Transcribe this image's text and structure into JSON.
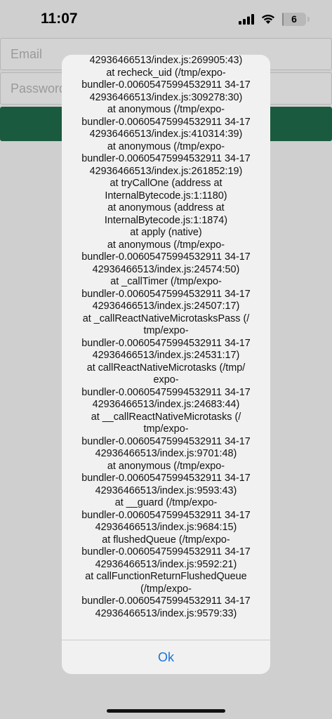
{
  "status_bar": {
    "time": "11:07",
    "battery_level": "6",
    "battery_fraction": 0.06
  },
  "login_form": {
    "email_placeholder": "Email",
    "password_placeholder": "Password"
  },
  "alert": {
    "lines": [
      "42936466513/index.js:269905:43)",
      "at recheck_uid (/tmp/expo-",
      "bundler-0.00605475994532911 34-17",
      "42936466513/index.js:309278:30)",
      "at anonymous (/tmp/expo-",
      "bundler-0.00605475994532911 34-17",
      "42936466513/index.js:410314:39)",
      "at anonymous (/tmp/expo-",
      "bundler-0.00605475994532911 34-17",
      "42936466513/index.js:261852:19)",
      "at tryCallOne (address at",
      "InternalBytecode.js:1:1180)",
      "at anonymous (address at",
      "InternalBytecode.js:1:1874)",
      "at apply (native)",
      "at anonymous (/tmp/expo-",
      "bundler-0.00605475994532911 34-17",
      "42936466513/index.js:24574:50)",
      "at _callTimer (/tmp/expo-",
      "bundler-0.00605475994532911 34-17",
      "42936466513/index.js:24507:17)",
      "at _callReactNativeMicrotasksPass (/",
      "tmp/expo-",
      "bundler-0.00605475994532911 34-17",
      "42936466513/index.js:24531:17)",
      "at callReactNativeMicrotasks (/tmp/",
      "expo-",
      "bundler-0.00605475994532911 34-17",
      "42936466513/index.js:24683:44)",
      "at __callReactNativeMicrotasks (/",
      "tmp/expo-",
      "bundler-0.00605475994532911 34-17",
      "42936466513/index.js:9701:48)",
      "at anonymous (/tmp/expo-",
      "bundler-0.00605475994532911 34-17",
      "42936466513/index.js:9593:43)",
      "at __guard (/tmp/expo-",
      "bundler-0.00605475994532911 34-17",
      "42936466513/index.js:9684:15)",
      "at flushedQueue (/tmp/expo-",
      "bundler-0.00605475994532911 34-17",
      "42936466513/index.js:9592:21)",
      "at callFunctionReturnFlushedQueue",
      "(/tmp/expo-",
      "bundler-0.00605475994532911 34-17",
      "42936466513/index.js:9579:33)"
    ],
    "ok_label": "Ok"
  },
  "colors": {
    "login_button": "#1a5b3f",
    "ok_text": "#1a73d9",
    "dim_background": "#cfcfcf"
  },
  "icons": [
    "signal-icon",
    "wifi-icon",
    "battery-icon"
  ]
}
